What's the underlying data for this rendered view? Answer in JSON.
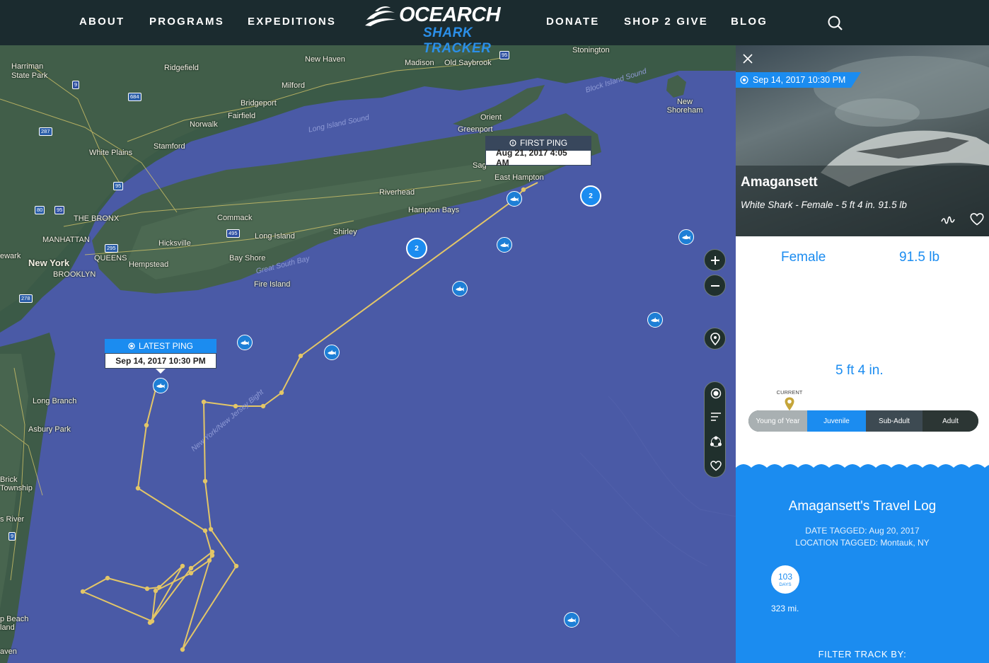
{
  "nav": {
    "items": [
      "ABOUT",
      "PROGRAMS",
      "EXPEDITIONS",
      "DONATE",
      "SHOP 2 GIVE",
      "BLOG"
    ],
    "logo_main": "OCEARCH",
    "logo_sub": "SHARK TRACKER"
  },
  "map": {
    "places": [
      "Harriman State Park",
      "Ridgefield",
      "New Haven",
      "Madison",
      "Old Saybrook",
      "Stonington",
      "Milford",
      "Bridgeport",
      "Norwalk",
      "Fairfield",
      "Stamford",
      "White Plains",
      "THE BRONX",
      "MANHATTAN",
      "QUEENS",
      "BROOKLYN",
      "New York",
      "ewark",
      "Hicksville",
      "Hempstead",
      "Commack",
      "Long Island",
      "Shirley",
      "Bay Shore",
      "Fire Island",
      "Riverhead",
      "Hampton Bays",
      "East Hampton",
      "Orient",
      "Greenport",
      "New Shoreham",
      "Long Branch",
      "Asbury Park",
      "Brick Township",
      "s River",
      "p Beach",
      "land",
      "aven",
      "Sag",
      "Block Island Sound",
      "Long Island Sound",
      "Great South Bay",
      "New York/New Jersey Bight"
    ],
    "highways": [
      "95",
      "684",
      "287",
      "9",
      "95",
      "80",
      "95",
      "278",
      "295",
      "495",
      "9"
    ],
    "clusters": [
      "2",
      "2"
    ],
    "first_ping": {
      "label": "FIRST PING",
      "date": "Aug 21, 2017 4:05 AM"
    },
    "latest_ping": {
      "label": "LATEST PING",
      "date": "Sep 14, 2017 10:30 PM"
    },
    "track_color": "#e3c667",
    "water_color": "#4a5aa6"
  },
  "panel": {
    "ping_date": "Sep 14, 2017 10:30 PM",
    "name": "Amagansett",
    "description": "White Shark - Female - 5 ft 4 in. 91.5 lb",
    "gender": "Female",
    "weight": "91.5 lb",
    "length": "5 ft 4 in.",
    "current_label": "CURRENT",
    "stages": [
      "Young of Year",
      "Juvenile",
      "Sub-Adult",
      "Adult"
    ],
    "travel_title": "Amagansett's Travel Log",
    "date_tagged": "DATE TAGGED: Aug 20, 2017",
    "location_tagged": "LOCATION TAGGED: Montauk, NY",
    "days": "103",
    "days_unit": "DAYS",
    "miles": "323 mi.",
    "filter": "FILTER TRACK BY:",
    "accent": "#1b8cf0"
  }
}
